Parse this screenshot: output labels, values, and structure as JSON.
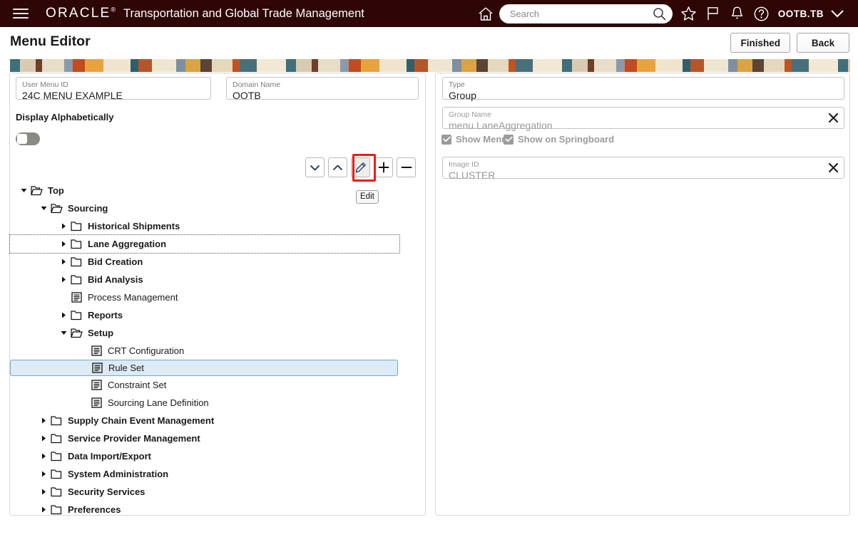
{
  "header": {
    "brand": "ORACLE",
    "brand_mark": "®",
    "app_name": "Transportation and Global Trade Management",
    "menu_icon": "hamburger-icon",
    "home_icon": "home-icon",
    "search": {
      "placeholder": "Search",
      "value": "",
      "icon": "search-icon"
    },
    "icons": [
      {
        "name": "favorites-star-icon",
        "glyph": "star"
      },
      {
        "name": "flag-icon",
        "glyph": "flag"
      },
      {
        "name": "notifications-bell-icon",
        "glyph": "bell"
      },
      {
        "name": "help-icon",
        "glyph": "question-circle"
      }
    ],
    "user": "OOTB.TB",
    "user_menu_icon": "chevron-down-icon",
    "background_color": "#2e0606"
  },
  "title_bar": {
    "title": "Menu Editor",
    "buttons": [
      {
        "name": "finished-button",
        "label": "Finished"
      },
      {
        "name": "back-button",
        "label": "Back"
      }
    ]
  },
  "banner": {
    "colors": [
      "#3f6f79",
      "#d8cbb0",
      "#6e3f26",
      "#e8ddc6",
      "#8a9aab",
      "#c44a1f",
      "#e8a33d",
      "#f0e4cd",
      "#2f5f6a",
      "#b5552a",
      "#efe6d2",
      "#7d8fa0",
      "#d9a441",
      "#5b4433",
      "#e4d8bd",
      "#c1531f",
      "#47707a",
      "#f2e8d4"
    ]
  },
  "left_panel": {
    "user_menu_id": {
      "label": "User Menu ID",
      "value": "24C MENU EXAMPLE"
    },
    "domain_name": {
      "label": "Domain Name",
      "value": "OOTB"
    },
    "display_alphabetically": {
      "label": "Display Alphabetically",
      "state": "off"
    },
    "toolbar": [
      {
        "name": "move-down-button",
        "icon": "chevron-down-icon",
        "highlighted": false
      },
      {
        "name": "move-up-button",
        "icon": "chevron-up-icon",
        "highlighted": false
      },
      {
        "name": "edit-button",
        "icon": "pencil-icon",
        "highlighted": true
      },
      {
        "name": "add-button",
        "icon": "plus-icon",
        "highlighted": false
      },
      {
        "name": "remove-button",
        "icon": "minus-icon",
        "highlighted": false
      }
    ],
    "tooltip": "Edit",
    "highlight_color": "#ee1c16",
    "tree": [
      {
        "label": "Top",
        "depth": 0,
        "type": "folder",
        "twisty": "expanded",
        "state": "normal"
      },
      {
        "label": "Sourcing",
        "depth": 1,
        "type": "folder",
        "twisty": "expanded",
        "state": "normal"
      },
      {
        "label": "Historical Shipments",
        "depth": 2,
        "type": "folder",
        "twisty": "collapsed",
        "state": "normal"
      },
      {
        "label": "Lane Aggregation",
        "depth": 2,
        "type": "folder",
        "twisty": "collapsed",
        "state": "focused"
      },
      {
        "label": "Bid Creation",
        "depth": 2,
        "type": "folder",
        "twisty": "collapsed",
        "state": "normal"
      },
      {
        "label": "Bid Analysis",
        "depth": 2,
        "type": "folder",
        "twisty": "collapsed",
        "state": "normal"
      },
      {
        "label": "Process Management",
        "depth": 2,
        "type": "document",
        "twisty": "none",
        "state": "normal"
      },
      {
        "label": "Reports",
        "depth": 2,
        "type": "folder",
        "twisty": "collapsed",
        "state": "normal"
      },
      {
        "label": "Setup",
        "depth": 2,
        "type": "folder",
        "twisty": "expanded",
        "state": "normal"
      },
      {
        "label": "CRT Configuration",
        "depth": 3,
        "type": "document",
        "twisty": "none",
        "state": "normal"
      },
      {
        "label": "Rule Set",
        "depth": 3,
        "type": "document",
        "twisty": "none",
        "state": "selected"
      },
      {
        "label": "Constraint Set",
        "depth": 3,
        "type": "document",
        "twisty": "none",
        "state": "normal"
      },
      {
        "label": "Sourcing Lane Definition",
        "depth": 3,
        "type": "document",
        "twisty": "none",
        "state": "normal"
      },
      {
        "label": "Supply Chain Event Management",
        "depth": 1,
        "type": "folder",
        "twisty": "collapsed",
        "state": "normal"
      },
      {
        "label": "Service Provider Management",
        "depth": 1,
        "type": "folder",
        "twisty": "collapsed",
        "state": "normal"
      },
      {
        "label": "Data Import/Export",
        "depth": 1,
        "type": "folder",
        "twisty": "collapsed",
        "state": "normal"
      },
      {
        "label": "System Administration",
        "depth": 1,
        "type": "folder",
        "twisty": "collapsed",
        "state": "normal"
      },
      {
        "label": "Security Services",
        "depth": 1,
        "type": "folder",
        "twisty": "collapsed",
        "state": "normal"
      },
      {
        "label": "Preferences",
        "depth": 1,
        "type": "folder",
        "twisty": "collapsed",
        "state": "normal"
      }
    ]
  },
  "right_panel": {
    "type": {
      "label": "Type",
      "value": "Group"
    },
    "group_name": {
      "label": "Group Name",
      "value": "menu.LaneAggregation",
      "clear_icon": "close-x-icon"
    },
    "image_id": {
      "label": "Image ID",
      "value": "CLUSTER",
      "clear_icon": "close-x-icon"
    },
    "checkboxes": [
      {
        "name": "show-menu-checkbox",
        "label": "Show Menu",
        "checked": true
      },
      {
        "name": "show-on-springboard-checkbox",
        "label": "Show on Springboard",
        "checked": true
      }
    ]
  }
}
